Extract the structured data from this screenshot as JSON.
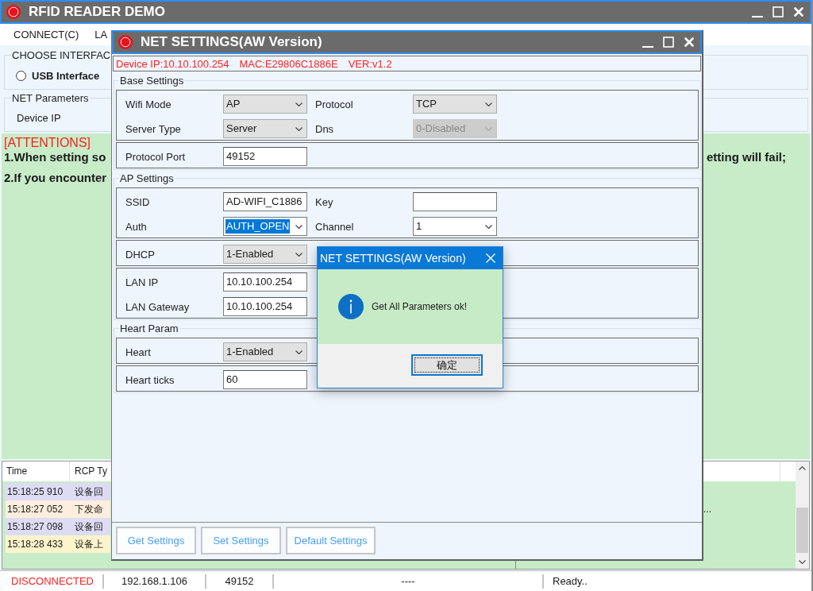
{
  "window": {
    "title": "RFID READER DEMO"
  },
  "menu": [
    {
      "label": "CONNECT(C)"
    },
    {
      "label": "LA"
    }
  ],
  "interface_group": {
    "title": "CHOOSE INTERFAC",
    "options": [
      {
        "label": "USB Interface",
        "selected": false
      }
    ]
  },
  "net_parameters": {
    "title": "NET Parameters",
    "fields": [
      {
        "label": "Device IP"
      }
    ]
  },
  "attentions": {
    "heading": "[ATTENTIONS]",
    "lines": [
      {
        "left": "1.When setting so",
        "right": "etting will fail;"
      },
      {
        "left": "2.If you encounter"
      }
    ]
  },
  "log": {
    "columns": [
      "Time",
      "RCP Ty"
    ],
    "rows": [
      {
        "time": "15:18:25 910",
        "type": "设备回",
        "color": "#dedcf5"
      },
      {
        "time": "15:18:27 052",
        "type": "下发命",
        "color": "#fdeedd",
        "detail": "..."
      },
      {
        "time": "15:18:27 098",
        "type": "设备回",
        "color": "#dedcf5"
      },
      {
        "time": "15:18:28 433",
        "type": "设备上",
        "color": "#fdf4cc"
      }
    ]
  },
  "status_bar": {
    "connection": {
      "text": "DISCONNECTED",
      "connected": false
    },
    "cells": [
      "192.168.1.106",
      "49152",
      "----",
      "Ready.."
    ]
  },
  "net_settings_dialog": {
    "title": "NET SETTINGS(AW Version)",
    "device_info": [
      "Device IP:10.10.100.254",
      "MAC:E29806C1886E",
      "VER:v1.2"
    ],
    "sections": [
      {
        "title": "Base Settings",
        "boxes": [
          {
            "rows": [
              {
                "fields": [
                  {
                    "label": "Wifi Mode",
                    "kind": "dropdown",
                    "value": "AP",
                    "disabled": false,
                    "text_selected": false
                  },
                  {
                    "label": "Protocol",
                    "kind": "dropdown",
                    "value": "TCP",
                    "disabled": false,
                    "text_selected": false
                  }
                ]
              },
              {
                "fields": [
                  {
                    "label": "Server Type",
                    "kind": "dropdown",
                    "value": "Server",
                    "disabled": false,
                    "text_selected": false
                  },
                  {
                    "label": "Dns",
                    "kind": "dropdown",
                    "value": "0-Disabled",
                    "disabled": true,
                    "text_selected": false
                  }
                ]
              }
            ]
          },
          {
            "rows": [
              {
                "fields": [
                  {
                    "label": "Protocol Port",
                    "kind": "text",
                    "value": "49152",
                    "disabled": false,
                    "text_selected": false
                  }
                ]
              }
            ]
          }
        ]
      },
      {
        "title": "AP Settings",
        "boxes": [
          {
            "rows": [
              {
                "fields": [
                  {
                    "label": "SSID",
                    "kind": "text",
                    "value": "AD-WIFI_C1886",
                    "disabled": false,
                    "text_selected": false
                  },
                  {
                    "label": "Key",
                    "kind": "text",
                    "disabled": false
                  }
                ]
              },
              {
                "fields": [
                  {
                    "label": "Auth",
                    "kind": "combo",
                    "value": "AUTH_OPEN",
                    "disabled": false,
                    "text_selected": true
                  },
                  {
                    "label": "Channel",
                    "kind": "combo",
                    "value": "1",
                    "disabled": false,
                    "text_selected": false
                  }
                ]
              }
            ]
          },
          {
            "rows": [
              {
                "fields": [
                  {
                    "label": "DHCP",
                    "kind": "dropdown",
                    "value": "1-Enabled",
                    "disabled": false,
                    "text_selected": false
                  }
                ]
              }
            ]
          },
          {
            "rows": [
              {
                "fields": [
                  {
                    "label": "LAN IP",
                    "kind": "text",
                    "value": "10.10.100.254",
                    "disabled": false,
                    "text_selected": false
                  }
                ]
              },
              {
                "fields": [
                  {
                    "label": "LAN Gateway",
                    "kind": "text",
                    "value": "10.10.100.254",
                    "disabled": false,
                    "text_selected": false
                  }
                ]
              }
            ]
          }
        ]
      },
      {
        "title": "Heart Param",
        "boxes": [
          {
            "rows": [
              {
                "fields": [
                  {
                    "label": "Heart",
                    "kind": "dropdown",
                    "value": "1-Enabled",
                    "disabled": false,
                    "text_selected": false
                  }
                ]
              }
            ]
          },
          {
            "rows": [
              {
                "fields": [
                  {
                    "label": "Heart ticks",
                    "kind": "text",
                    "value": "60",
                    "disabled": false,
                    "text_selected": false
                  }
                ]
              }
            ]
          }
        ]
      }
    ],
    "buttons": [
      "Get Settings",
      "Set Settings",
      "Default Settings"
    ]
  },
  "message_box": {
    "title": "NET SETTINGS(AW Version)",
    "message": "Get All Parameters ok!",
    "buttons": [
      {
        "label": "确定",
        "focused": true
      }
    ]
  }
}
